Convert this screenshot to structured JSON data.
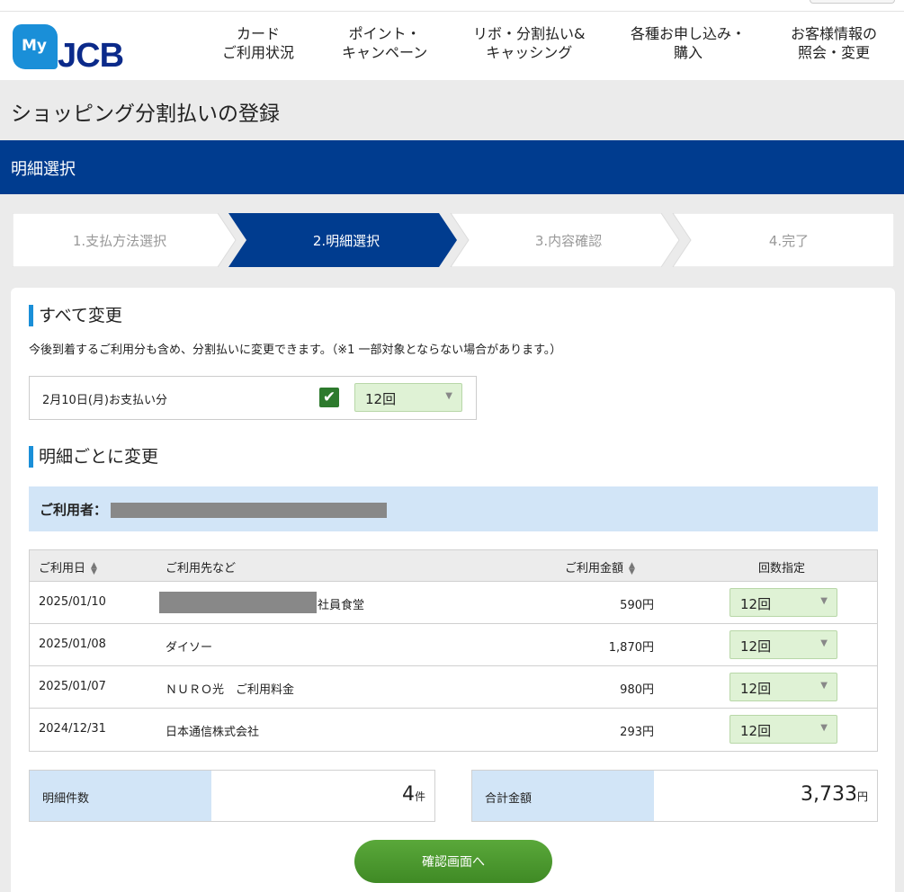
{
  "logo": {
    "my": "My",
    "brand": "JCB"
  },
  "nav": [
    {
      "line1": "カード",
      "line2": "ご利用状況"
    },
    {
      "line1": "ポイント・",
      "line2": "キャンペーン"
    },
    {
      "line1": "リボ・分割払い&",
      "line2": "キャッシング"
    },
    {
      "line1": "各種お申し込み・",
      "line2": "購入"
    },
    {
      "line1": "お客様情報の",
      "line2": "照会・変更"
    }
  ],
  "page_title": "ショッピング分割払いの登録",
  "section_title": "明細選択",
  "steps": [
    {
      "label": "1.支払方法選択",
      "active": false
    },
    {
      "label": "2.明細選択",
      "active": true
    },
    {
      "label": "3.内容確認",
      "active": false
    },
    {
      "label": "4.完了",
      "active": false
    }
  ],
  "all_change": {
    "heading": "すべて変更",
    "note": "今後到着するご利用分も含め、分割払いに変更できます。（※1 一部対象とならない場合があります。）",
    "payment_label": "2月10日(月)お支払い分",
    "checked": true,
    "installments": "12回"
  },
  "per_item": {
    "heading": "明細ごとに変更",
    "user_label": "ご利用者："
  },
  "table": {
    "headers": {
      "date": "ご利用日",
      "merchant": "ご利用先など",
      "amount": "ご利用金額",
      "count": "回数指定"
    },
    "rows": [
      {
        "date": "2025/01/10",
        "merchant": "社員食堂",
        "amount": "590円",
        "installments": "12回"
      },
      {
        "date": "2025/01/08",
        "merchant": "ダイソー",
        "amount": "1,870円",
        "installments": "12回"
      },
      {
        "date": "2025/01/07",
        "merchant": "ＮＵＲＯ光　ご利用料金",
        "amount": "980円",
        "installments": "12回"
      },
      {
        "date": "2024/12/31",
        "merchant": "日本通信株式会社",
        "amount": "293円",
        "installments": "12回"
      }
    ]
  },
  "totals": {
    "count_label": "明細件数",
    "count_value": "4",
    "count_unit": "件",
    "sum_label": "合計金額",
    "sum_value": "3,733",
    "sum_unit": "円"
  },
  "confirm_button": "確認画面へ",
  "colors": {
    "brand_navy": "#003c8f",
    "accent_blue": "#1a8fd8",
    "select_green": "#dff2d5",
    "button_green": "#4a9a2f"
  }
}
